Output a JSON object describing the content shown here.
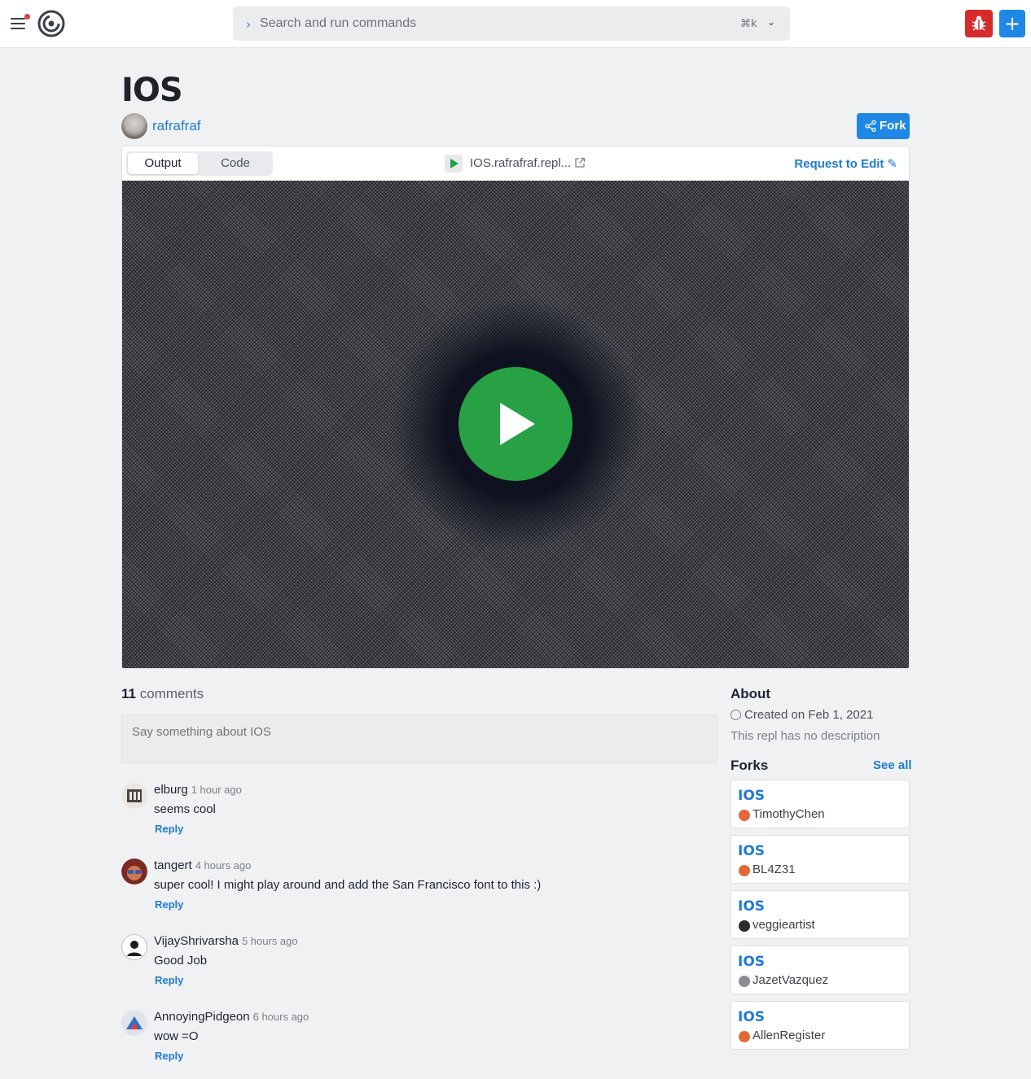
{
  "header": {
    "search_placeholder": "Search and run commands",
    "search_shortcut": "⌘k"
  },
  "repl": {
    "title": "IOS",
    "owner": "rafrafraf",
    "fork_label": "Fork",
    "tabs": [
      "Output",
      "Code"
    ],
    "url": "IOS.rafrafraf.repl...",
    "request_edit_label": "Request to Edit"
  },
  "comments": {
    "count": "11",
    "count_label": "comments",
    "input_placeholder": "Say something about IOS",
    "reply_label": "Reply",
    "items": [
      {
        "user": "elburg",
        "time": "1 hour ago",
        "text": "seems cool"
      },
      {
        "user": "tangert",
        "time": "4 hours ago",
        "text": "super cool! I might play around and add the San Francisco font to this :)"
      },
      {
        "user": "VijayShrivarsha",
        "time": "5 hours ago",
        "text": "Good Job"
      },
      {
        "user": "AnnoyingPidgeon",
        "time": "6 hours ago",
        "text": "wow =O"
      }
    ]
  },
  "about": {
    "heading": "About",
    "created": "Created on Feb 1, 2021",
    "description": "This repl has no description"
  },
  "forks": {
    "heading": "Forks",
    "see_all": "See all",
    "items": [
      {
        "title": "IOS",
        "user": "TimothyChen"
      },
      {
        "title": "IOS",
        "user": "BL4Z31"
      },
      {
        "title": "IOS",
        "user": "veggieartist"
      },
      {
        "title": "IOS",
        "user": "JazetVazquez"
      },
      {
        "title": "IOS",
        "user": "AllenRegister"
      }
    ]
  },
  "colors": {
    "accent": "#1f87e6",
    "danger": "#d52b2b",
    "run_green": "#27a144"
  }
}
